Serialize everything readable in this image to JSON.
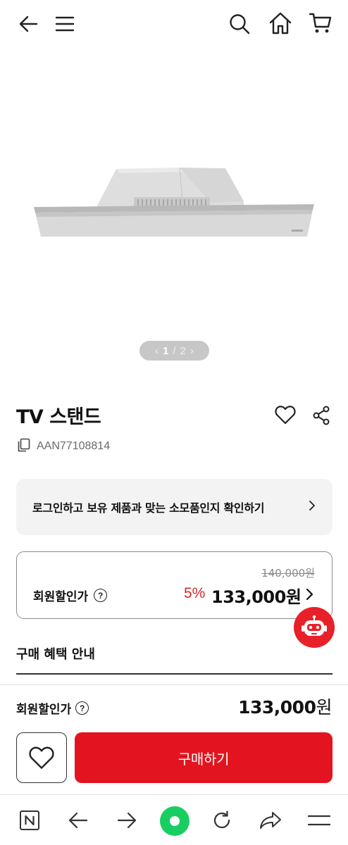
{
  "header": {
    "back_icon": "arrow-left-icon",
    "menu_icon": "hamburger-icon",
    "search_icon": "search-icon",
    "home_icon": "home-icon",
    "cart_icon": "cart-icon"
  },
  "gallery": {
    "current": "1",
    "separator": "/",
    "total": "2"
  },
  "product": {
    "title": "TV 스탠드",
    "model": "AAN77108814"
  },
  "login_banner": {
    "text": "로그인하고 보유 제품과 맞는 소모품인지 확인하기"
  },
  "price_box": {
    "original_price": "140,000원",
    "label": "회원할인가",
    "discount_rate": "5%",
    "price": "133,000원"
  },
  "benefit": {
    "title": "구매 혜택 안내"
  },
  "bottom_panel": {
    "label": "회원할인가",
    "price_number": "133,000",
    "price_unit": "원",
    "buy_label": "구매하기"
  },
  "browser_nav": {
    "items": [
      "naver-n-icon",
      "back-arrow-icon",
      "forward-arrow-icon",
      "green-home-dot-icon",
      "refresh-icon",
      "share-icon",
      "menu-icon"
    ]
  },
  "colors": {
    "accent_red": "#e3141f",
    "discount_red": "#d42a2a",
    "naver_green": "#19ce60"
  }
}
